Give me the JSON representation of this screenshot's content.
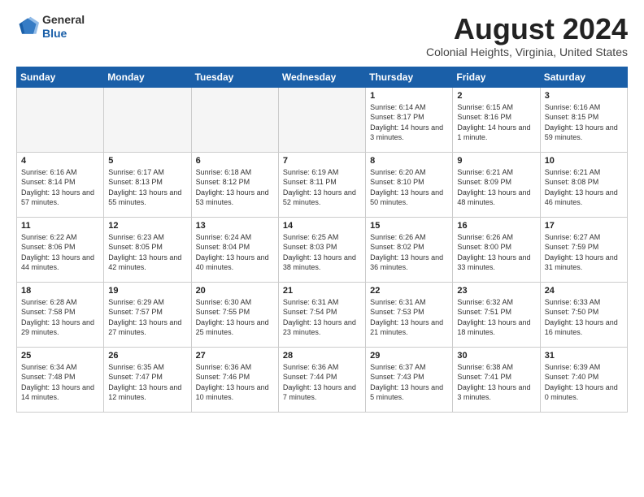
{
  "header": {
    "logo_line1": "General",
    "logo_line2": "Blue",
    "month_year": "August 2024",
    "location": "Colonial Heights, Virginia, United States"
  },
  "weekdays": [
    "Sunday",
    "Monday",
    "Tuesday",
    "Wednesday",
    "Thursday",
    "Friday",
    "Saturday"
  ],
  "weeks": [
    [
      {
        "day": "",
        "info": ""
      },
      {
        "day": "",
        "info": ""
      },
      {
        "day": "",
        "info": ""
      },
      {
        "day": "",
        "info": ""
      },
      {
        "day": "1",
        "info": "Sunrise: 6:14 AM\nSunset: 8:17 PM\nDaylight: 14 hours\nand 3 minutes."
      },
      {
        "day": "2",
        "info": "Sunrise: 6:15 AM\nSunset: 8:16 PM\nDaylight: 14 hours\nand 1 minute."
      },
      {
        "day": "3",
        "info": "Sunrise: 6:16 AM\nSunset: 8:15 PM\nDaylight: 13 hours\nand 59 minutes."
      }
    ],
    [
      {
        "day": "4",
        "info": "Sunrise: 6:16 AM\nSunset: 8:14 PM\nDaylight: 13 hours\nand 57 minutes."
      },
      {
        "day": "5",
        "info": "Sunrise: 6:17 AM\nSunset: 8:13 PM\nDaylight: 13 hours\nand 55 minutes."
      },
      {
        "day": "6",
        "info": "Sunrise: 6:18 AM\nSunset: 8:12 PM\nDaylight: 13 hours\nand 53 minutes."
      },
      {
        "day": "7",
        "info": "Sunrise: 6:19 AM\nSunset: 8:11 PM\nDaylight: 13 hours\nand 52 minutes."
      },
      {
        "day": "8",
        "info": "Sunrise: 6:20 AM\nSunset: 8:10 PM\nDaylight: 13 hours\nand 50 minutes."
      },
      {
        "day": "9",
        "info": "Sunrise: 6:21 AM\nSunset: 8:09 PM\nDaylight: 13 hours\nand 48 minutes."
      },
      {
        "day": "10",
        "info": "Sunrise: 6:21 AM\nSunset: 8:08 PM\nDaylight: 13 hours\nand 46 minutes."
      }
    ],
    [
      {
        "day": "11",
        "info": "Sunrise: 6:22 AM\nSunset: 8:06 PM\nDaylight: 13 hours\nand 44 minutes."
      },
      {
        "day": "12",
        "info": "Sunrise: 6:23 AM\nSunset: 8:05 PM\nDaylight: 13 hours\nand 42 minutes."
      },
      {
        "day": "13",
        "info": "Sunrise: 6:24 AM\nSunset: 8:04 PM\nDaylight: 13 hours\nand 40 minutes."
      },
      {
        "day": "14",
        "info": "Sunrise: 6:25 AM\nSunset: 8:03 PM\nDaylight: 13 hours\nand 38 minutes."
      },
      {
        "day": "15",
        "info": "Sunrise: 6:26 AM\nSunset: 8:02 PM\nDaylight: 13 hours\nand 36 minutes."
      },
      {
        "day": "16",
        "info": "Sunrise: 6:26 AM\nSunset: 8:00 PM\nDaylight: 13 hours\nand 33 minutes."
      },
      {
        "day": "17",
        "info": "Sunrise: 6:27 AM\nSunset: 7:59 PM\nDaylight: 13 hours\nand 31 minutes."
      }
    ],
    [
      {
        "day": "18",
        "info": "Sunrise: 6:28 AM\nSunset: 7:58 PM\nDaylight: 13 hours\nand 29 minutes."
      },
      {
        "day": "19",
        "info": "Sunrise: 6:29 AM\nSunset: 7:57 PM\nDaylight: 13 hours\nand 27 minutes."
      },
      {
        "day": "20",
        "info": "Sunrise: 6:30 AM\nSunset: 7:55 PM\nDaylight: 13 hours\nand 25 minutes."
      },
      {
        "day": "21",
        "info": "Sunrise: 6:31 AM\nSunset: 7:54 PM\nDaylight: 13 hours\nand 23 minutes."
      },
      {
        "day": "22",
        "info": "Sunrise: 6:31 AM\nSunset: 7:53 PM\nDaylight: 13 hours\nand 21 minutes."
      },
      {
        "day": "23",
        "info": "Sunrise: 6:32 AM\nSunset: 7:51 PM\nDaylight: 13 hours\nand 18 minutes."
      },
      {
        "day": "24",
        "info": "Sunrise: 6:33 AM\nSunset: 7:50 PM\nDaylight: 13 hours\nand 16 minutes."
      }
    ],
    [
      {
        "day": "25",
        "info": "Sunrise: 6:34 AM\nSunset: 7:48 PM\nDaylight: 13 hours\nand 14 minutes."
      },
      {
        "day": "26",
        "info": "Sunrise: 6:35 AM\nSunset: 7:47 PM\nDaylight: 13 hours\nand 12 minutes."
      },
      {
        "day": "27",
        "info": "Sunrise: 6:36 AM\nSunset: 7:46 PM\nDaylight: 13 hours\nand 10 minutes."
      },
      {
        "day": "28",
        "info": "Sunrise: 6:36 AM\nSunset: 7:44 PM\nDaylight: 13 hours\nand 7 minutes."
      },
      {
        "day": "29",
        "info": "Sunrise: 6:37 AM\nSunset: 7:43 PM\nDaylight: 13 hours\nand 5 minutes."
      },
      {
        "day": "30",
        "info": "Sunrise: 6:38 AM\nSunset: 7:41 PM\nDaylight: 13 hours\nand 3 minutes."
      },
      {
        "day": "31",
        "info": "Sunrise: 6:39 AM\nSunset: 7:40 PM\nDaylight: 13 hours\nand 0 minutes."
      }
    ]
  ]
}
